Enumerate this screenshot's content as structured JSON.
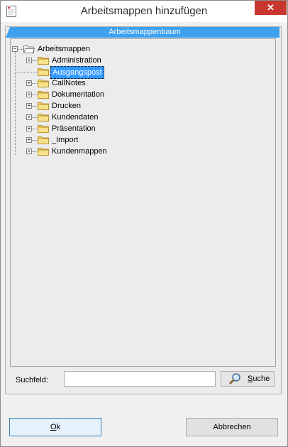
{
  "window": {
    "title": "Arbeitsmappen hinzufügen",
    "close_glyph": "✕"
  },
  "group": {
    "header": "Arbeitsmappenbaum"
  },
  "tree": {
    "root": {
      "label": "Arbeitsmappen",
      "expander": "−",
      "icon": "open-folder-icon"
    },
    "items": [
      {
        "label": "Administration",
        "expander": "+",
        "selected": false
      },
      {
        "label": "Ausgangspost",
        "expander": "",
        "selected": true
      },
      {
        "label": "CallNotes",
        "expander": "+",
        "selected": false
      },
      {
        "label": "Dokumentation",
        "expander": "+",
        "selected": false
      },
      {
        "label": "Drucken",
        "expander": "+",
        "selected": false
      },
      {
        "label": "Kundendaten",
        "expander": "+",
        "selected": false
      },
      {
        "label": "Präsentation",
        "expander": "+",
        "selected": false
      },
      {
        "label": "_Import",
        "expander": "+",
        "selected": false
      },
      {
        "label": "Kundenmappen",
        "expander": "+",
        "selected": false
      }
    ]
  },
  "search": {
    "label": "Suchfeld:",
    "value": "",
    "placeholder": "",
    "button_label": "Suche",
    "button_icon": "search-magnifier-icon"
  },
  "buttons": {
    "ok": "Ok",
    "cancel": "Abbrechen"
  },
  "colors": {
    "selection": "#3399ff",
    "header": "#3da1f0",
    "close": "#c7372e",
    "folder": "#f5d36b"
  }
}
